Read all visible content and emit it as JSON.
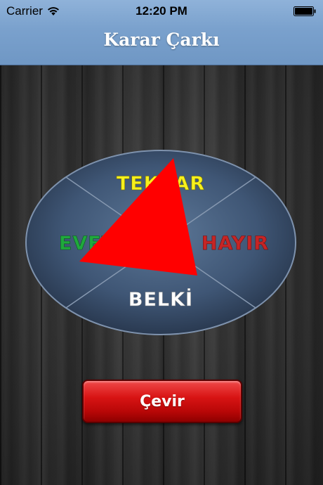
{
  "status_bar": {
    "carrier": "Carrier",
    "time": "12:20 PM"
  },
  "nav": {
    "title": "Karar Çarkı"
  },
  "wheel": {
    "segments": [
      {
        "label": "TEKRAR",
        "color": "#f7f01c"
      },
      {
        "label": "EVET",
        "color": "#1fa93c"
      },
      {
        "label": "HAYIR",
        "color": "#c62525"
      },
      {
        "label": "BELKİ",
        "color": "#ffffff"
      }
    ],
    "pointer_color": "#ff0000"
  },
  "spin_button": {
    "label": "Çevir",
    "color": "#d81414"
  },
  "icons": [
    "wifi-icon",
    "battery-icon",
    "pointer-arrow-icon"
  ]
}
